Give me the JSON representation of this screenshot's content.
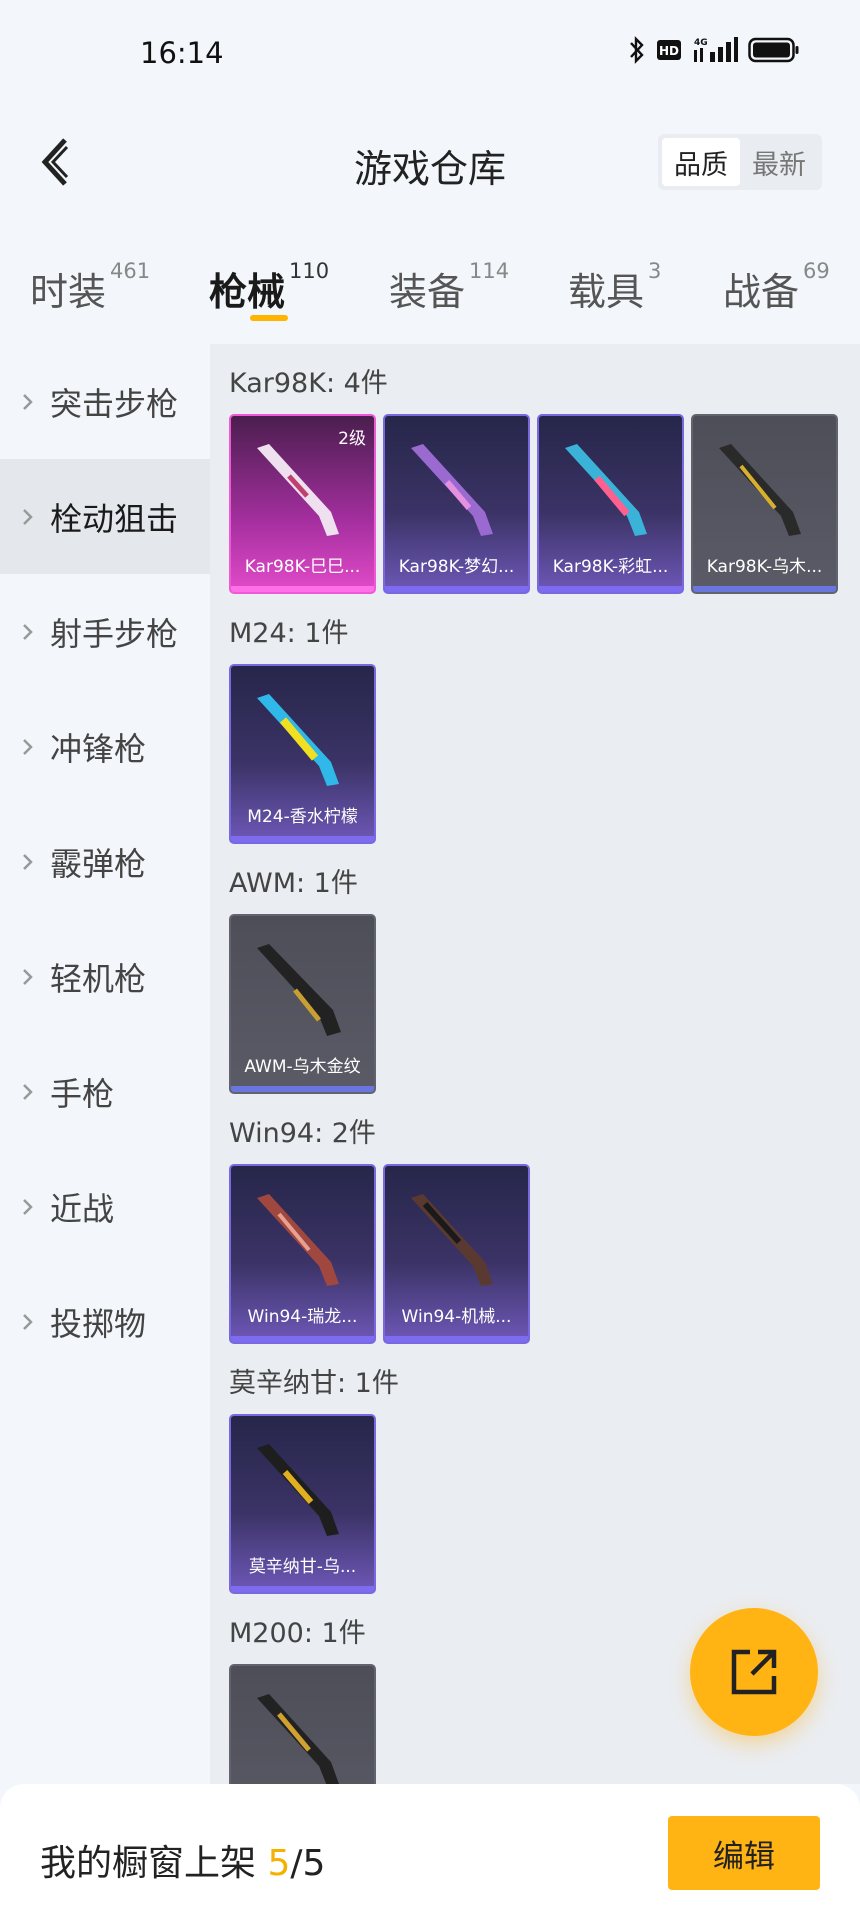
{
  "status_bar": {
    "time": "16:14"
  },
  "header": {
    "title": "游戏仓库",
    "sort_options": [
      "品质",
      "最新"
    ]
  },
  "tabs": [
    {
      "label": "时装",
      "count": "461"
    },
    {
      "label": "枪械",
      "count": "110"
    },
    {
      "label": "装备",
      "count": "114"
    },
    {
      "label": "载具",
      "count": "3"
    },
    {
      "label": "战备",
      "count": "69"
    }
  ],
  "sidebar": {
    "items": [
      "突击步枪",
      "栓动狙击",
      "射手步枪",
      "冲锋枪",
      "霰弹枪",
      "轻机枪",
      "手枪",
      "近战",
      "投掷物"
    ]
  },
  "groups": [
    {
      "title": "Kar98K: 4件",
      "items": [
        {
          "name": "Kar98K-巳巳...",
          "level": "2级"
        },
        {
          "name": "Kar98K-梦幻..."
        },
        {
          "name": "Kar98K-彩虹..."
        },
        {
          "name": "Kar98K-乌木..."
        }
      ]
    },
    {
      "title": "M24: 1件",
      "items": [
        {
          "name": "M24-香水柠檬"
        }
      ]
    },
    {
      "title": "AWM: 1件",
      "items": [
        {
          "name": "AWM-乌木金纹"
        }
      ]
    },
    {
      "title": "Win94: 2件",
      "items": [
        {
          "name": "Win94-瑞龙..."
        },
        {
          "name": "Win94-机械..."
        }
      ]
    },
    {
      "title": "莫辛纳甘: 1件",
      "items": [
        {
          "name": "莫辛纳甘-乌..."
        }
      ]
    },
    {
      "title": "M200: 1件",
      "items": []
    }
  ],
  "bottom_bar": {
    "label": "我的橱窗上架 ",
    "current": "5",
    "total": "/5",
    "edit_label": "编辑"
  }
}
